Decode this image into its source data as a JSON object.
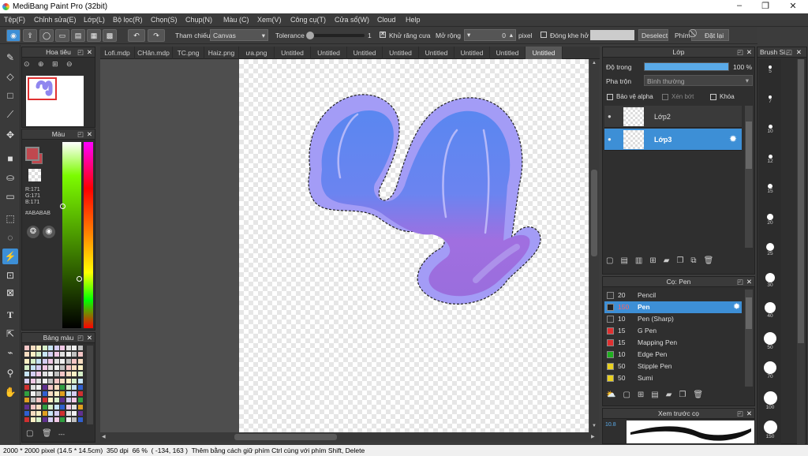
{
  "window": {
    "title": "MediBang Paint Pro (32bit)",
    "controls": [
      "–",
      "❐",
      "✕"
    ]
  },
  "menu": [
    "Tệp(F)",
    "Chỉnh sửa(E)",
    "Lớp(L)",
    "Bộ lọc(R)",
    "Chọn(S)",
    "Chụp(N)",
    "Màu (C)",
    "Xem(V)",
    "Công cụ(T)",
    "Cửa sổ(W)",
    "Cloud",
    "Help"
  ],
  "toolbar": {
    "tham_chieu_label": "Tham chiếu",
    "tham_chieu_value": "Canvas",
    "tolerance_label": "Tolerance",
    "tolerance_value": "1",
    "khu_rang_cua_label": "Khử răng cưa",
    "mo_rong_label": "Mở rộng",
    "mo_rong_value": "0",
    "pixel_label": "pixel",
    "dong_khe_ho_label": "Đóng khe hở",
    "deselect_label": "Deselect",
    "phim_label": "Phím",
    "dat_lai_label": "Đặt lại"
  },
  "navigator": {
    "title": "Hoa tiêu"
  },
  "color_panel": {
    "title": "Màu",
    "r": "R:171",
    "g": "G:171",
    "b": "B:171",
    "hex": "#ABABAB",
    "fg_color": "#c0484f",
    "bg_color": "#ffffff"
  },
  "palette_panel": {
    "title": "Bảng màu",
    "more": "---"
  },
  "tabs": [
    "Lofi.mdp",
    "CHân.mdp",
    "TC.png",
    "Haiz.png",
    "ưa.png",
    "Untitled",
    "Untitled",
    "Untitled",
    "Untitled",
    "Untitled",
    "Untitled",
    "Untitled",
    "Untitled"
  ],
  "active_tab": 12,
  "layer_panel": {
    "title": "Lớp",
    "opacity_label": "Độ trong",
    "opacity_value": "100 %",
    "opacity_fraction": 1.0,
    "blend_label": "Pha trộn",
    "blend_value": "Bình thường",
    "protect_alpha": "Bảo vệ alpha",
    "clipping": "Xén bớt",
    "lock": "Khóa",
    "layers": [
      {
        "name": "Lớp2",
        "selected": false
      },
      {
        "name": "Lớp3",
        "selected": true
      }
    ]
  },
  "brush_panel": {
    "title": "Cọ: Pen",
    "brushes": [
      {
        "size": "20",
        "name": "Pencil",
        "color": "#333333",
        "selected": false
      },
      {
        "size": "150",
        "name": "Pen",
        "color": "#222222",
        "selected": true
      },
      {
        "size": "10",
        "name": "Pen (Sharp)",
        "color": "#333333",
        "selected": false
      },
      {
        "size": "15",
        "name": "G Pen",
        "color": "#e03030",
        "selected": false
      },
      {
        "size": "15",
        "name": "Mapping Pen",
        "color": "#e03030",
        "selected": false
      },
      {
        "size": "10",
        "name": "Edge Pen",
        "color": "#20b020",
        "selected": false
      },
      {
        "size": "50",
        "name": "Stipple Pen",
        "color": "#e8d020",
        "selected": false
      },
      {
        "size": "50",
        "name": "Sumi",
        "color": "#e8d020",
        "selected": false
      }
    ]
  },
  "preview_panel": {
    "title": "Xem trước cọ",
    "size": "10.8"
  },
  "brush_size_panel": {
    "title": "Brush Si...",
    "sizes": [
      "5",
      "7",
      "10",
      "12",
      "15",
      "20",
      "25",
      "30",
      "40",
      "50",
      "70",
      "100",
      "150"
    ]
  },
  "status": {
    "canvas_size": "2000 * 2000 pixel",
    "physical_size": "(14.5 * 14.5cm)",
    "dpi": "350 dpi",
    "zoom": "66 %",
    "coords": "( -134, 163 )",
    "hint": "Thêm bằng cách giữ phím Ctrl cùng với phím Shift, Delete"
  },
  "colors": {
    "accent": "#3d8fd6",
    "hue_red": "#ff0000",
    "canvas_fill_light": "#9f98f5",
    "canvas_fill_blue": "#5a87f0",
    "canvas_fill_purple": "#a06fe0"
  }
}
